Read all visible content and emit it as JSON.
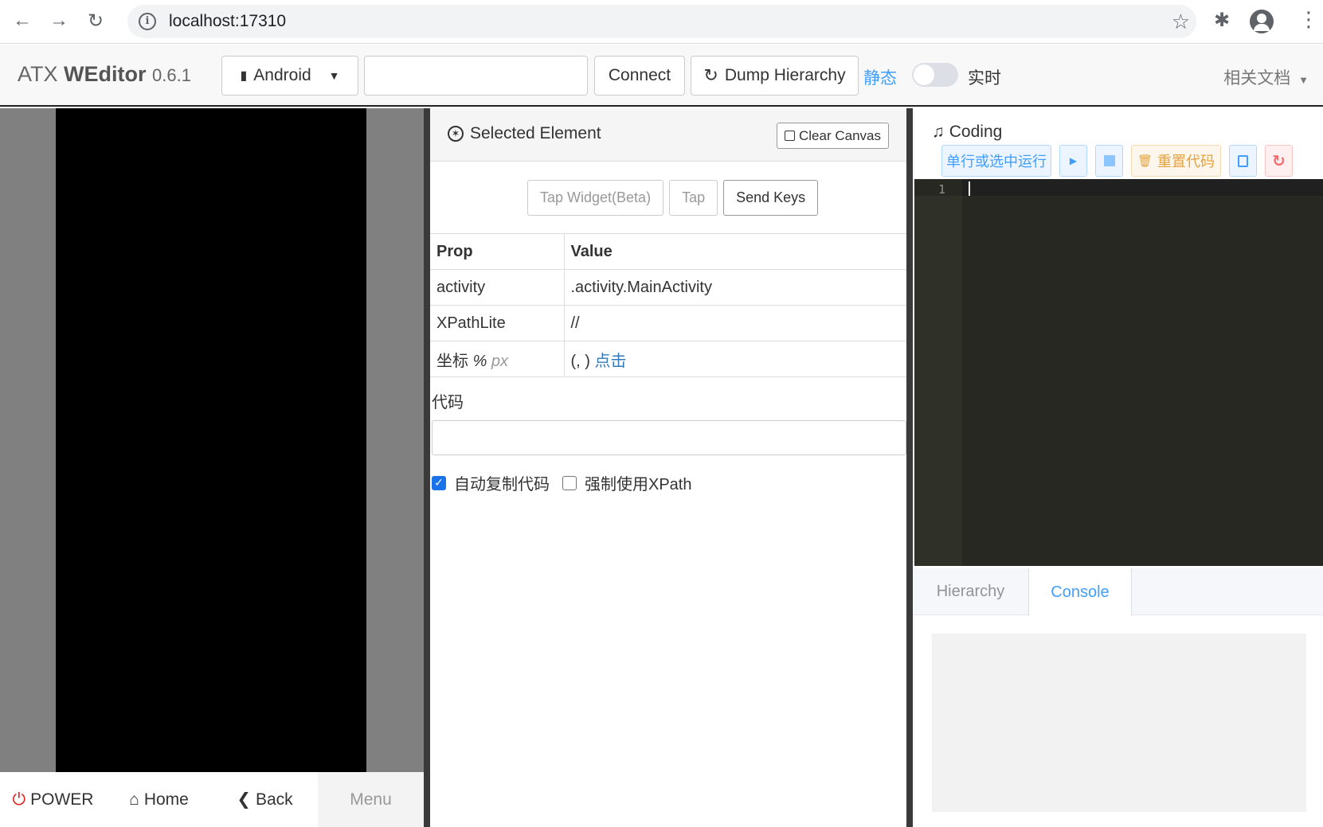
{
  "browser": {
    "url": "localhost:17310"
  },
  "header": {
    "brand_prefix": "ATX",
    "brand_name": "WEditor",
    "version": "0.6.1",
    "platform_select": "Android",
    "device_input_value": "",
    "connect_label": "Connect",
    "dump_label": "Dump Hierarchy",
    "static_label": "静态",
    "realtime_label": "实时",
    "realtime_enabled": false,
    "docs_label": "相关文档"
  },
  "phone": {
    "power_label": "POWER",
    "home_label": "Home",
    "back_label": "Back",
    "menu_label": "Menu"
  },
  "selected": {
    "title": "Selected Element",
    "clear_canvas_label": "Clear Canvas",
    "actions": {
      "tap_widget": "Tap Widget(Beta)",
      "tap": "Tap",
      "send_keys": "Send Keys"
    },
    "table": {
      "col_prop": "Prop",
      "col_value": "Value",
      "rows": [
        {
          "prop": "activity",
          "value": ".activity.MainActivity"
        },
        {
          "prop": "XPathLite",
          "value": "//"
        }
      ],
      "coord_prop": "坐标",
      "coord_percent": "%",
      "coord_px": "px",
      "coord_value": "(, )",
      "coord_link": "点击"
    },
    "code_label": "代码",
    "code_value": "",
    "auto_copy_label": "自动复制代码",
    "auto_copy_checked": true,
    "force_xpath_label": "强制使用XPath",
    "force_xpath_checked": false
  },
  "coding": {
    "title": "Coding",
    "run_line_label": "单行或选中运行",
    "reset_code_label": "重置代码",
    "line_number": "1",
    "tabs": [
      "Hierarchy",
      "Console"
    ],
    "active_tab": "Console",
    "colors": {
      "editor_bg": "#272822",
      "primary": "#409eff",
      "warning": "#e6a23c",
      "danger": "#f56c6c"
    }
  }
}
